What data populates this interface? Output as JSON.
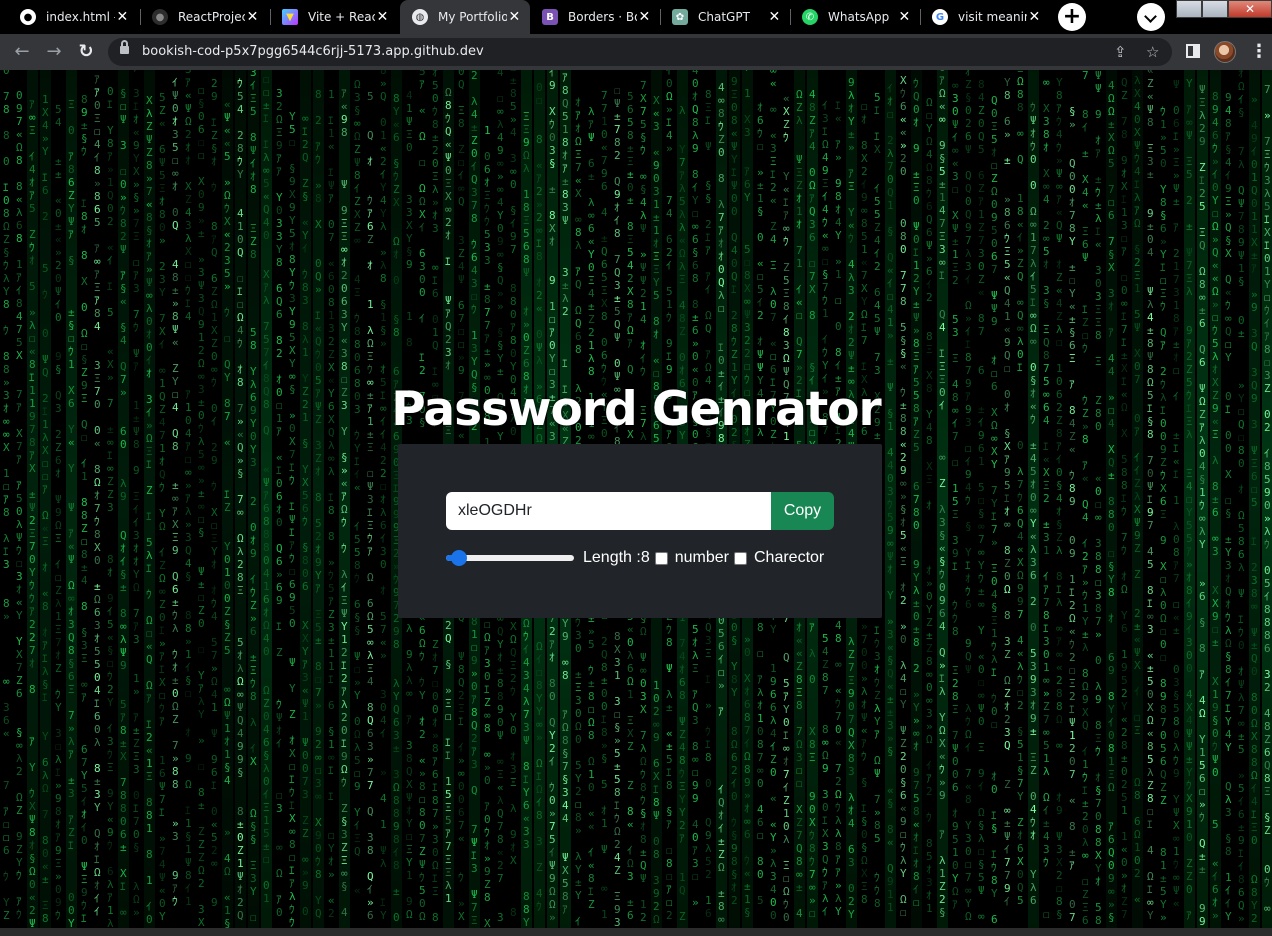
{
  "browser": {
    "tabs": [
      {
        "title": "index.html -",
        "icon": "github-icon",
        "active": false
      },
      {
        "title": "ReactProject",
        "icon": "github-icon",
        "active": false
      },
      {
        "title": "Vite + React",
        "icon": "vite-icon",
        "active": false
      },
      {
        "title": "My Portfolio",
        "icon": "globe-icon",
        "active": true
      },
      {
        "title": "Borders · Bo",
        "icon": "bootstrap-icon",
        "active": false
      },
      {
        "title": "ChatGPT",
        "icon": "chatgpt-icon",
        "active": false
      },
      {
        "title": "WhatsApp",
        "icon": "whatsapp-icon",
        "active": false
      },
      {
        "title": "visit meanin",
        "icon": "google-icon",
        "active": false
      }
    ],
    "url": "bookish-cod-p5x7pgg6544c6rjj-5173.app.github.dev",
    "new_tab_label": "+"
  },
  "page": {
    "title": "Password Genrator",
    "password": "xleOGDHr",
    "copy_label": "Copy",
    "length_label": "Length :8",
    "length_level": 0.1,
    "number_label": "number",
    "character_label": "Charector",
    "number_checked": false,
    "character_checked": false,
    "colors": {
      "card": "#212529",
      "copy_button": "#198754",
      "slider": "#1a73e8",
      "matrix_green": "#00c040"
    }
  }
}
